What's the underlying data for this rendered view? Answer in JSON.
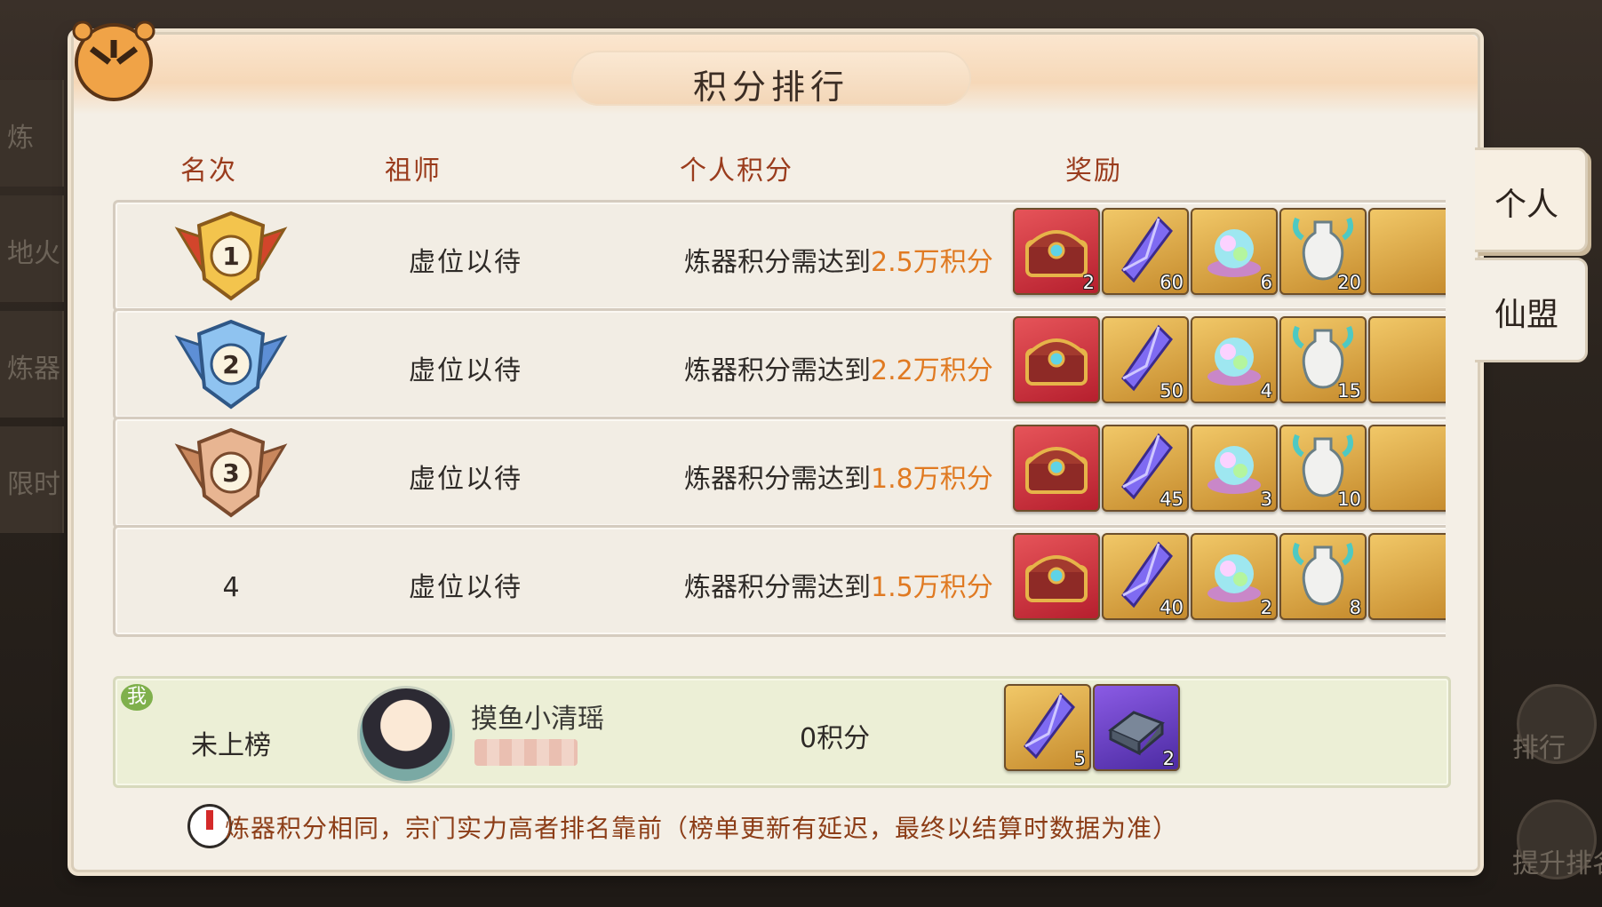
{
  "title": "积分排行",
  "columns": {
    "rank": "名次",
    "master": "祖师",
    "score": "个人积分",
    "reward": "奖励"
  },
  "rows": [
    {
      "rank": "1",
      "name": "虚位以待",
      "req_prefix": "炼器积分需达到",
      "req_value": "2.5万积分",
      "rewards": [
        {
          "type": "chest",
          "qty": "2"
        },
        {
          "type": "crystal",
          "qty": "60"
        },
        {
          "type": "orb",
          "qty": "6"
        },
        {
          "type": "vase",
          "qty": "20"
        }
      ]
    },
    {
      "rank": "2",
      "name": "虚位以待",
      "req_prefix": "炼器积分需达到",
      "req_value": "2.2万积分",
      "rewards": [
        {
          "type": "chest",
          "qty": ""
        },
        {
          "type": "crystal",
          "qty": "50"
        },
        {
          "type": "orb",
          "qty": "4"
        },
        {
          "type": "vase",
          "qty": "15"
        }
      ]
    },
    {
      "rank": "3",
      "name": "虚位以待",
      "req_prefix": "炼器积分需达到",
      "req_value": "1.8万积分",
      "rewards": [
        {
          "type": "chest",
          "qty": ""
        },
        {
          "type": "crystal",
          "qty": "45"
        },
        {
          "type": "orb",
          "qty": "3"
        },
        {
          "type": "vase",
          "qty": "10"
        }
      ]
    },
    {
      "rank": "4",
      "name": "虚位以待",
      "req_prefix": "炼器积分需达到",
      "req_value": "1.5万积分",
      "rewards": [
        {
          "type": "chest",
          "qty": ""
        },
        {
          "type": "crystal",
          "qty": "40"
        },
        {
          "type": "orb",
          "qty": "2"
        },
        {
          "type": "vase",
          "qty": "8"
        }
      ]
    }
  ],
  "me": {
    "badge": "我",
    "rank": "未上榜",
    "name": "摸鱼小清瑶",
    "score": "0积分",
    "rewards": [
      {
        "type": "crystal",
        "qty": "5"
      },
      {
        "type": "ingot",
        "qty": "2"
      }
    ]
  },
  "notice": "炼器积分相同，宗门实力高者排名靠前（榜单更新有延迟，最终以结算时数据为准）",
  "tabs": [
    {
      "label": "个人"
    },
    {
      "label": "仙盟"
    }
  ],
  "background": {
    "left_tabs": [
      "炼",
      "地火",
      "炼器",
      "限时"
    ],
    "right_buttons": [
      "排行",
      "提升排名"
    ]
  },
  "colors": {
    "highlight": "#e07a22",
    "header_text": "#9a3c1d",
    "me_row": "#ecefd6"
  }
}
